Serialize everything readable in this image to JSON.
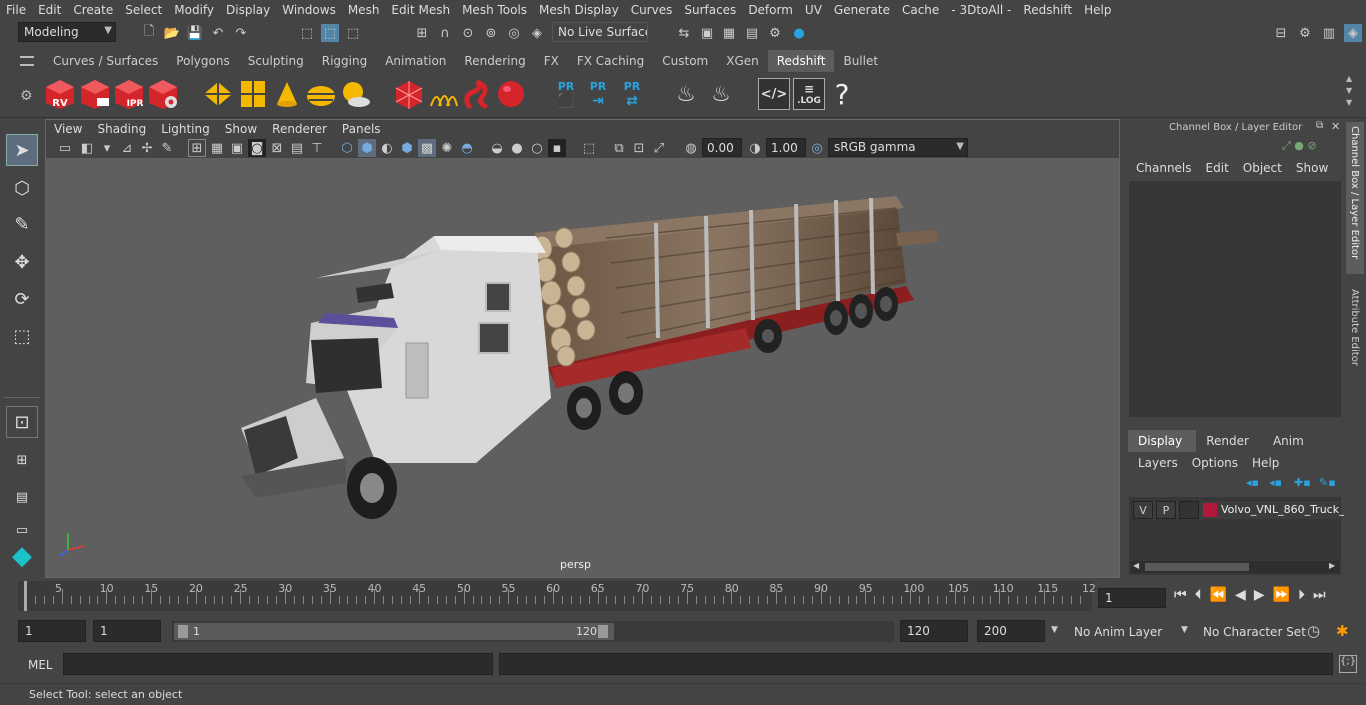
{
  "menubar": {
    "items": [
      "File",
      "Edit",
      "Create",
      "Select",
      "Modify",
      "Display",
      "Windows",
      "Mesh",
      "Edit Mesh",
      "Mesh Tools",
      "Mesh Display",
      "Curves",
      "Surfaces",
      "Deform",
      "UV",
      "Generate",
      "Cache",
      "- 3DtoAll -",
      "Redshift",
      "Help"
    ]
  },
  "status_line": {
    "mode": "Modeling",
    "live_surface": "No Live Surface"
  },
  "shelf": {
    "tabs": [
      "Curves / Surfaces",
      "Polygons",
      "Sculpting",
      "Rigging",
      "Animation",
      "Rendering",
      "FX",
      "FX Caching",
      "Custom",
      "XGen",
      "Redshift",
      "Bullet"
    ],
    "active_tab": "Redshift",
    "icons": {
      "rv": "RV",
      "ipr": "IPR",
      "pr1": "PR",
      "pr2": "PR",
      "pr3": "PR",
      "log": ".LOG",
      "help": "?"
    },
    "colors": {
      "redshift_red": "#d4252b",
      "yellow": "#f5b800",
      "blue": "#29a3e0"
    }
  },
  "viewport": {
    "menus": [
      "View",
      "Shading",
      "Lighting",
      "Show",
      "Renderer",
      "Panels"
    ],
    "exposure": "0.00",
    "gamma": "1.00",
    "color_space": "sRGB gamma",
    "camera_label": "persp"
  },
  "channel_box": {
    "title": "Channel Box / Layer Editor",
    "menus": [
      "Channels",
      "Edit",
      "Object",
      "Show"
    ]
  },
  "layer_editor": {
    "tabs": [
      "Display",
      "Render",
      "Anim"
    ],
    "active_tab": "Display",
    "menus": [
      "Layers",
      "Options",
      "Help"
    ],
    "layer": {
      "v": "V",
      "p": "P",
      "name": "Volvo_VNL_860_Truck_",
      "color": "#b0193a"
    }
  },
  "side_tabs": [
    "Channel Box / Layer Editor",
    "Attribute Editor"
  ],
  "timeline": {
    "ticks": [
      "5",
      "10",
      "15",
      "20",
      "25",
      "30",
      "35",
      "40",
      "45",
      "50",
      "55",
      "60",
      "65",
      "70",
      "75",
      "80",
      "85",
      "90",
      "95",
      "100",
      "105",
      "110",
      "115",
      "12"
    ],
    "start_marker": "1",
    "current_frame": "1"
  },
  "range": {
    "start": "1",
    "playback_start": "1",
    "slider_start": "1",
    "slider_end": "120",
    "playback_end": "120",
    "end": "200",
    "anim_layer": "No Anim Layer",
    "character_set": "No Character Set"
  },
  "command_line": {
    "label": "MEL"
  },
  "help_line": {
    "text": "Select Tool: select an object"
  }
}
